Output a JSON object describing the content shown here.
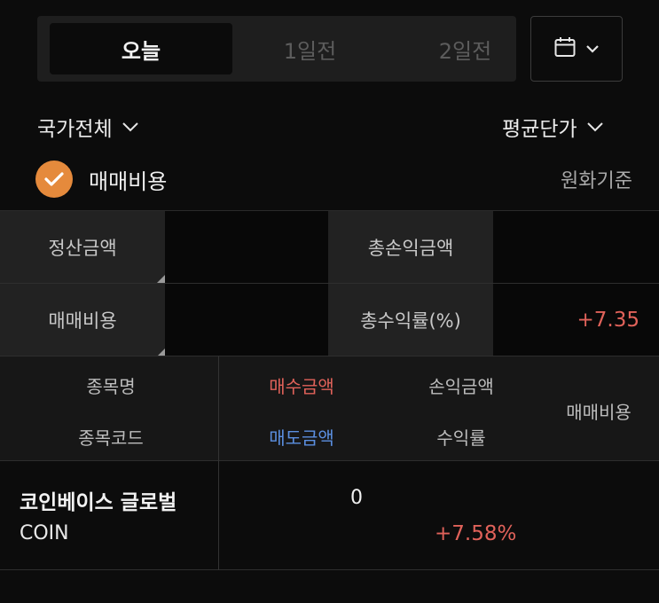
{
  "tabs": [
    {
      "label": "오늘",
      "active": true
    },
    {
      "label": "1일전",
      "active": false
    },
    {
      "label": "2일전",
      "active": false
    }
  ],
  "filters": {
    "country": "국가전체",
    "price_basis": "평균단가"
  },
  "fee_option": {
    "label": "매매비용",
    "checked": true,
    "currency_basis": "원화기준"
  },
  "summary": {
    "settlement_label": "정산금액",
    "settlement_value": "",
    "total_pl_label": "총손익금액",
    "total_pl_value": "",
    "fee_label": "매매비용",
    "fee_value": "",
    "total_return_label": "총수익률(%)",
    "total_return_value": "+7.35"
  },
  "table_header": {
    "name": "종목명",
    "code": "종목코드",
    "buy_amount": "매수금액",
    "sell_amount": "매도금액",
    "pl_amount": "손익금액",
    "return_rate": "수익률",
    "fee": "매매비용"
  },
  "rows": [
    {
      "name": "코인베이스 글로벌",
      "code": "COIN",
      "buy_amount": "0",
      "return_rate": "+7.58%"
    }
  ],
  "colors": {
    "accent_orange": "#e58a3c",
    "positive_red": "#e0625a",
    "sell_blue": "#5b8fe0"
  }
}
